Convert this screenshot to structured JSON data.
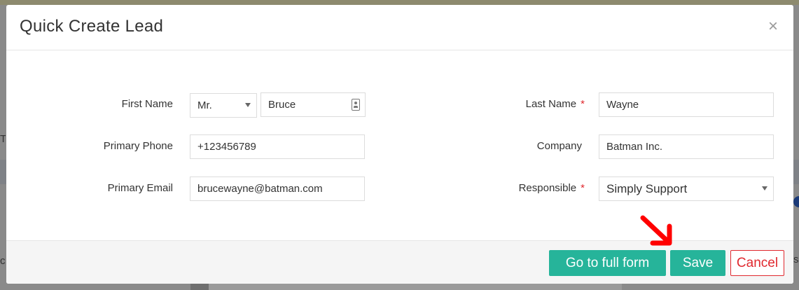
{
  "modal": {
    "title": "Quick Create Lead",
    "close_symbol": "×",
    "close_icon": "close-icon"
  },
  "form": {
    "first_name": {
      "label": "First Name",
      "salutation": "Mr.",
      "value": "Bruce",
      "icon": "contact-card-icon"
    },
    "primary_phone": {
      "label": "Primary Phone",
      "value": "+123456789"
    },
    "primary_email": {
      "label": "Primary Email",
      "value": "brucewayne@batman.com"
    },
    "last_name": {
      "label": "Last Name",
      "required_mark": "*",
      "value": "Wayne"
    },
    "company": {
      "label": "Company",
      "value": "Batman Inc."
    },
    "responsible": {
      "label": "Responsible",
      "required_mark": "*",
      "value": "Simply Support"
    }
  },
  "footer": {
    "full_form_label": "Go to full form",
    "save_label": "Save",
    "cancel_label": "Cancel"
  },
  "colors": {
    "primary_button": "#26b49a",
    "cancel": "#e0282e",
    "required": "#e0282e",
    "annotation_arrow": "#ff0000"
  }
}
